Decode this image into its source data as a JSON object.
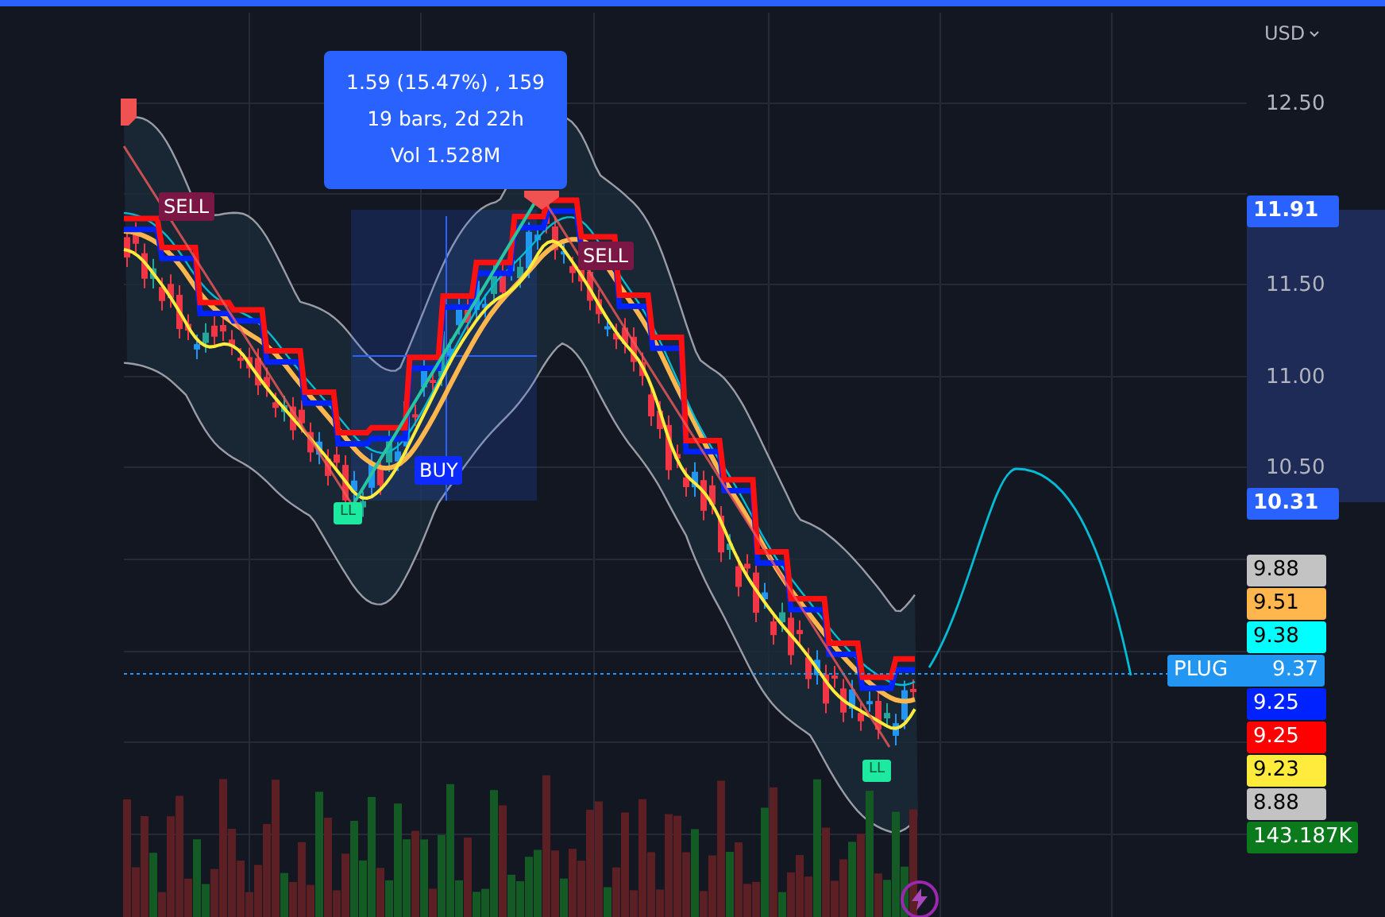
{
  "price_axis": {
    "currency": "USD",
    "ticks": [
      "12.50",
      "11.50",
      "11.00",
      "10.50"
    ]
  },
  "measure_tooltip": {
    "lines": [
      "1.59 (15.47%) , 159",
      "19 bars, 2d 22h",
      "Vol 1.528M"
    ]
  },
  "signals": [
    {
      "kind": "sell",
      "label": "SELL"
    },
    {
      "kind": "sell",
      "label": "SELL"
    },
    {
      "kind": "buy",
      "label": "BUY"
    },
    {
      "kind": "low",
      "label": "LL"
    },
    {
      "kind": "low",
      "label": "LL"
    }
  ],
  "range_labels": [
    {
      "text": "11.91",
      "color": "#2962ff"
    },
    {
      "text": "10.31",
      "color": "#2962ff"
    }
  ],
  "price_labels": [
    {
      "text": "9.88",
      "color": "#c3c3c3"
    },
    {
      "text": "9.51",
      "color": "#ffb74d"
    },
    {
      "text": "9.38",
      "color": "#00ffff"
    },
    {
      "kind": "symbol",
      "symbol": "PLUG",
      "text": "9.37",
      "color": "#2196f3"
    },
    {
      "text": "9.25",
      "color": "#0022ff"
    },
    {
      "text": "9.25",
      "color": "#ff0000"
    },
    {
      "text": "9.23",
      "color": "#ffeb3b"
    },
    {
      "text": "8.88",
      "color": "#c3c3c3"
    },
    {
      "text": "143.187K",
      "color": "#0a7a1d"
    }
  ]
}
